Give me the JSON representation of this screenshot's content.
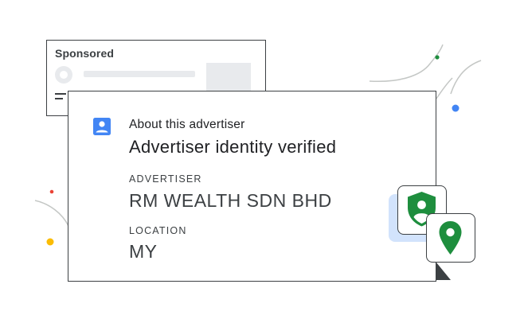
{
  "sponsored_card": {
    "label": "Sponsored"
  },
  "about_card": {
    "heading": "About this advertiser",
    "title": "Advertiser identity verified",
    "advertiser_label": "ADVERTISER",
    "advertiser_value": "RM WEALTH SDN BHD",
    "location_label": "LOCATION",
    "location_value": "MY"
  },
  "icons": {
    "profile": "account-box-icon",
    "shield": "verified-user-shield-icon",
    "location": "location-pin-icon",
    "globe": "globe-icon"
  },
  "colors": {
    "google_blue": "#4285f4",
    "google_green": "#34a853",
    "google_yellow": "#fbbc04",
    "google_red": "#ea4335",
    "outline": "#3c4043",
    "badge_highlight": "#d2e3fc"
  }
}
